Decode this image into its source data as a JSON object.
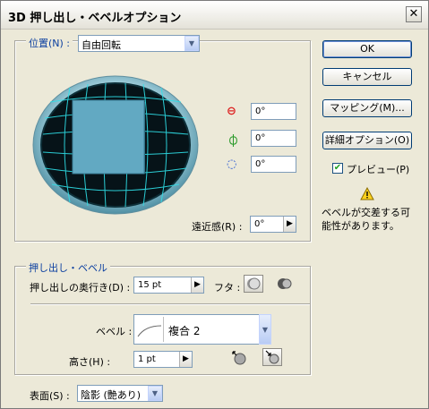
{
  "dialog": {
    "title": "3D 押し出し・ベベルオプション",
    "close_label": "✕"
  },
  "position": {
    "legend": "位置(N) :",
    "preset": "自由回転",
    "rot_x": "0°",
    "rot_y": "0°",
    "rot_z": "0°",
    "perspective_label": "遠近感(R) :",
    "perspective": "0°"
  },
  "buttons": {
    "ok": "OK",
    "cancel": "キャンセル",
    "mapping": "マッピング(M)...",
    "more_options": "詳細オプション(O)"
  },
  "preview": {
    "label": "プレビュー(P)",
    "checked": true
  },
  "warning": {
    "text_line1": "ベベルが交差する可",
    "text_line2": "能性があります。"
  },
  "extrude": {
    "legend": "押し出し・ベベル",
    "depth_label": "押し出しの奥行き(D) :",
    "depth": "15 pt",
    "cap_label": "フタ :",
    "bevel_label": "ベベル :",
    "bevel": "複合 2",
    "height_label": "高さ(H) :",
    "height": "1 pt"
  },
  "surface": {
    "label": "表面(S) :",
    "value": "陰影 (艶あり)"
  },
  "colors": {
    "accent": "#0b3fa0",
    "sphere_grid": "#2fe0e8",
    "cube": "#62a9c2"
  },
  "icons": {
    "rot_x": "rotate-x-icon",
    "rot_y": "rotate-y-icon",
    "rot_z": "rotate-z-icon",
    "warning": "warning-icon",
    "cap_on": "cap-on-icon",
    "cap_off": "cap-off-icon",
    "bevel_out": "bevel-out-icon",
    "bevel_in": "bevel-in-icon"
  }
}
